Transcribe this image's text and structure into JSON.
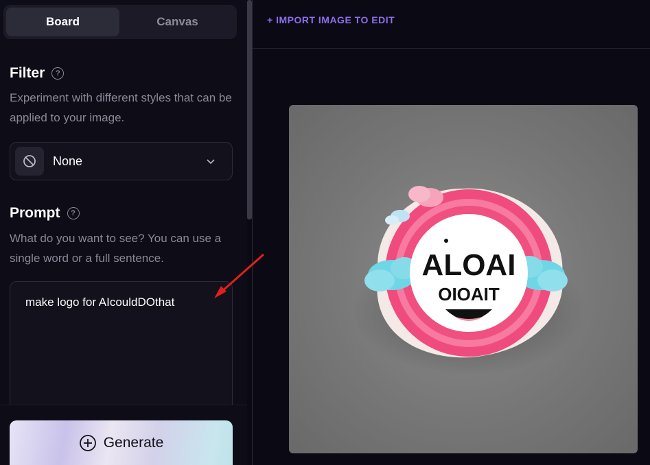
{
  "tabs": [
    {
      "label": "Board",
      "active": true
    },
    {
      "label": "Canvas",
      "active": false
    }
  ],
  "filter": {
    "title": "Filter",
    "description": "Experiment with different styles that can be applied to your image.",
    "selected": "None",
    "icon": "no-symbol-icon"
  },
  "prompt": {
    "title": "Prompt",
    "description": "What do you want to see? You can use a single word or a full sentence.",
    "value": "make logo for AIcouldDOthat"
  },
  "generate": {
    "label": "Generate",
    "icon": "plus-circle-icon"
  },
  "import_link": "+ IMPORT IMAGE TO EDIT",
  "logo": {
    "line1": "ALOAI",
    "line2": "OIOAIT"
  },
  "colors": {
    "accent": "#8f6df0",
    "arrow": "#e0201c",
    "logo_pink": "#f4467e",
    "cloud": "#6fd6e6"
  }
}
